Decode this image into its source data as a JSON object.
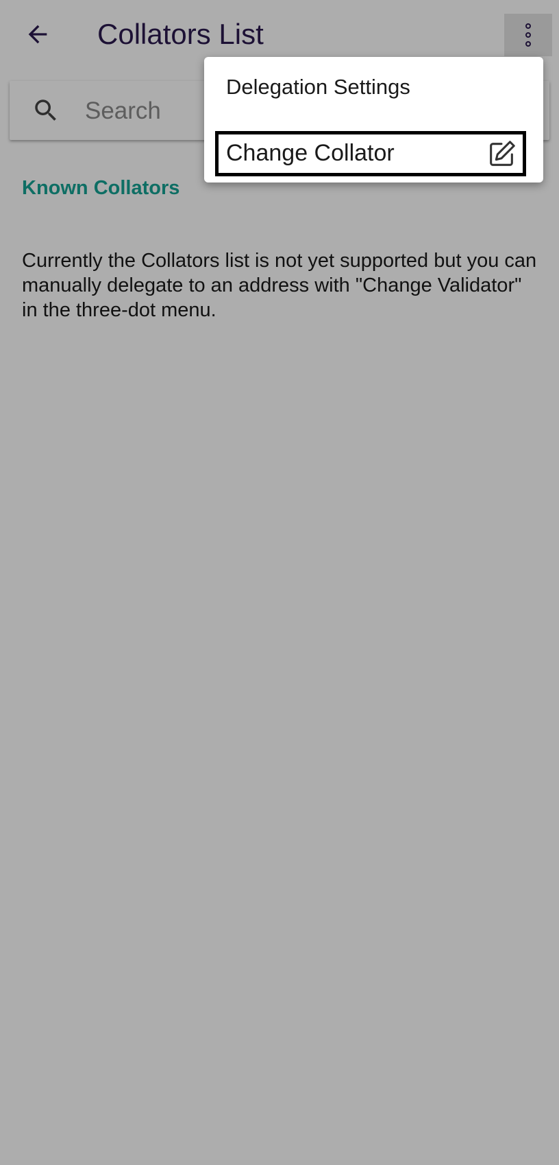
{
  "app_bar": {
    "back_icon": "arrow-left-icon",
    "title": "Collators List",
    "overflow_icon": "more-vertical-icon"
  },
  "search": {
    "icon": "search-icon",
    "placeholder": "Search",
    "value": ""
  },
  "content": {
    "section_heading": "Known Collators",
    "info_text": "Currently the Collators list is not yet supported but you can manually delegate to an address with \"Change Validator\" in the three-dot menu."
  },
  "menu": {
    "items": [
      {
        "label": "Delegation Settings"
      },
      {
        "label": "Change Collator",
        "icon": "edit-square-icon"
      }
    ]
  },
  "colors": {
    "title": "#2b1a4f",
    "accent": "#16a394",
    "scrim": "rgba(0,0,0,0.32)"
  }
}
